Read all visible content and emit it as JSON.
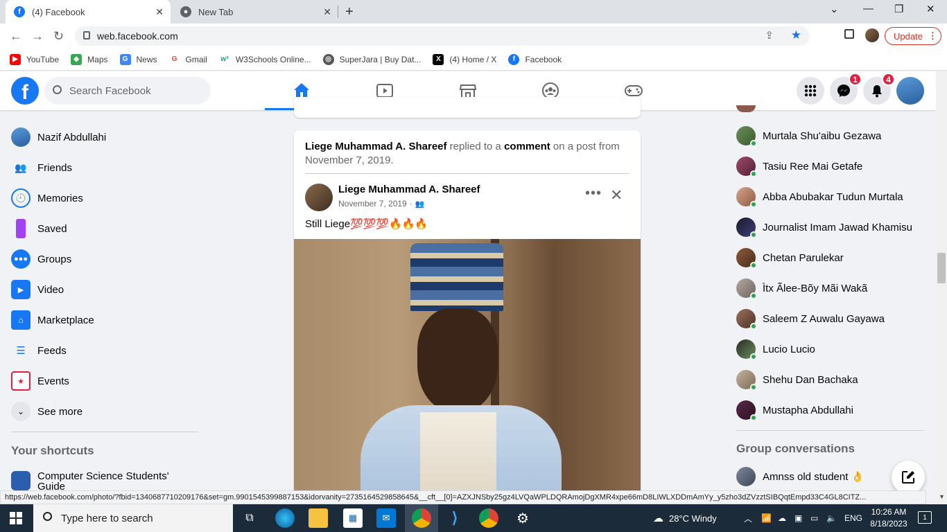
{
  "browser": {
    "tabs": [
      {
        "title": "(4) Facebook",
        "active": true
      },
      {
        "title": "New Tab",
        "active": false
      }
    ],
    "url": "web.facebook.com",
    "update_label": "Update",
    "bookmarks": [
      {
        "label": "YouTube",
        "color": "#ff0000"
      },
      {
        "label": "Maps",
        "color": "#34a853"
      },
      {
        "label": "News",
        "color": "#4285f4"
      },
      {
        "label": "Gmail",
        "color": "#ea4335"
      },
      {
        "label": "W3Schools Online...",
        "color": "#04aa6d"
      },
      {
        "label": "SuperJara | Buy Dat...",
        "color": "#555555"
      },
      {
        "label": "(4) Home / X",
        "color": "#000000"
      },
      {
        "label": "Facebook",
        "color": "#1877f2"
      }
    ],
    "status_url": "https://web.facebook.com/photo/?fbid=1340687710209176&set=gm.9901545399887153&idorvanity=2735164529858645&__cft__[0]=AZXJNSby25gz4LVQaWPLDQRAmojDgXMR4xpe66mD8LIWLXDDmAmYy_y5zho3dZVzztSIBQqtEmpd33C4GL8CITZ..."
  },
  "header": {
    "search_placeholder": "Search Facebook",
    "messenger_badge": "1",
    "notifications_badge": "4",
    "accent": "#1877f2"
  },
  "left_nav": {
    "profile_name": "Nazif Abdullahi",
    "items": [
      {
        "label": "Friends",
        "icon": "friends-icon",
        "color": "#1877f2"
      },
      {
        "label": "Memories",
        "icon": "memories-icon",
        "color": "#1877f2"
      },
      {
        "label": "Saved",
        "icon": "saved-icon",
        "color": "#a142f4"
      },
      {
        "label": "Groups",
        "icon": "groups-icon",
        "color": "#1877f2"
      },
      {
        "label": "Video",
        "icon": "video-icon",
        "color": "#1877f2"
      },
      {
        "label": "Marketplace",
        "icon": "marketplace-icon",
        "color": "#1877f2"
      },
      {
        "label": "Feeds",
        "icon": "feeds-icon",
        "color": "#1877f2"
      },
      {
        "label": "Events",
        "icon": "events-icon",
        "color": "#e41e3f"
      },
      {
        "label": "See more",
        "icon": "chevron-down-icon",
        "color": "#e4e6eb"
      }
    ],
    "shortcuts_title": "Your shortcuts",
    "shortcut_item": "Computer Science Students' Guide"
  },
  "post": {
    "activity_actor": "Liege Muhammad A. Shareef",
    "activity_mid": " replied to a ",
    "activity_link": "comment",
    "activity_tail": " on a post from November 7, 2019.",
    "author": "Liege Muhammad A. Shareef",
    "date": "November 7, 2019",
    "text": "Still Liege💯💯💯🔥🔥🔥"
  },
  "contacts": [
    "Murtala Shu'aibu Gezawa",
    "Tasiu Ree Mai Getafe",
    "Abba Abubakar Tudun Murtala",
    "Journalist Imam Jawad Khamisu",
    "Chetan Parulekar",
    "Ìtx Ãlee-Bõy Mãi Wakã",
    "Saleem Z Auwalu Gayawa",
    "Lucio Lucio",
    "Shehu Dan Bachaka",
    "Mustapha Abdullahi"
  ],
  "group_conversations": {
    "title": "Group conversations",
    "item": "Amnss old student 👌"
  },
  "taskbar": {
    "search_placeholder": "Type here to search",
    "weather": "28°C  Windy",
    "language": "ENG",
    "time": "10:26 AM",
    "date": "8/18/2023",
    "notif_count": "1"
  }
}
